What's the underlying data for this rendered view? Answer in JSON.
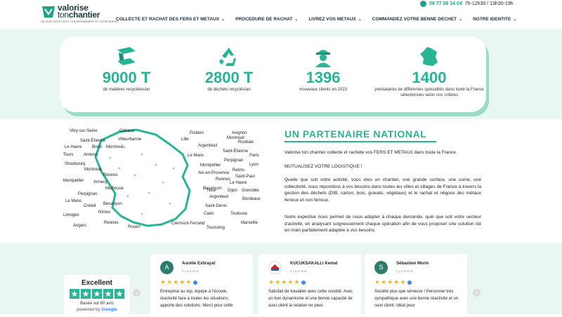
{
  "header": {
    "brand_line1": "valorise",
    "brand_line2a": "ton",
    "brand_line2b": "chantier",
    "tagline": "ON VOUS INCITE AVEC L'ENVIRONNEMENT ET VOTRE BUDGET",
    "phone": "09 77 08 14 04",
    "hours": "7h-12h30 / 13h30-19h",
    "nav": [
      {
        "label": "COLLECTE ET RACHAT DES FERS ET METAUX"
      },
      {
        "label": "PROCEDURE DE RACHAT"
      },
      {
        "label": "LIVREZ VOS METAUX"
      },
      {
        "label": "COMMANDEZ VOTRE BENNE DECHET"
      },
      {
        "label": "NOTRE IDENTITE"
      }
    ]
  },
  "stats": [
    {
      "icon": "steel-beam-icon",
      "value": "9000 T",
      "label": "de matières recyclées/an"
    },
    {
      "icon": "recycle-icon",
      "value": "2800 T",
      "label": "de déchets recyclés/an"
    },
    {
      "icon": "worker-icon",
      "value": "1396",
      "label": "nouveaux clients en 2023"
    },
    {
      "icon": "france-map-icon",
      "value": "1400",
      "label": "prestataires de différentes spécialités dans toute la France sélectionnés selon nos critères"
    }
  ],
  "map_cities_left": [
    "Vitry-sur-Seine",
    "Orléans",
    "Saint-Étienne",
    "Villeurbanne",
    "Le Havre",
    "Brest",
    "Montreuil",
    "Tours",
    "Amiens",
    "Strasbourg",
    "Montreuil",
    "Rennes",
    "Montpellier",
    "Annecy",
    "Mulhouse",
    "Perpignan",
    "Le Mans",
    "Besançon",
    "Créteil",
    "Nîmes",
    "Limoges",
    "Angers",
    "Rennes",
    "Rouen"
  ],
  "map_cities_right": [
    "Poitiers",
    "Avignon",
    "Montreuil",
    "Lille",
    "Roubaix",
    "Argenteuil",
    "Saint-Étienne",
    "Le Mans",
    "Paris",
    "Perpignan",
    "Montpellier",
    "Lyon",
    "Reims",
    "Aix-en-Provence",
    "Saint-Paul",
    "Rennes",
    "Le Havre",
    "Besançon",
    "Nice",
    "Dijon",
    "Grenoble",
    "Argenteuil",
    "Bordeaux",
    "Saint-Denis",
    "Caen",
    "Toulouse",
    "Clermont-Ferrand",
    "Marseille",
    "Tourcoing"
  ],
  "partner": {
    "title": "UN PARTENAIRE NATIONAL",
    "p1": "Valorise ton chantier collecte et rachète vos FERS ET METAUX  dans toute la France.",
    "p2": "MUTUALISEZ VOTRE LOGISTIQUE !",
    "p3": "Quelle que soit votre activité, vous etes un chantier, une grande surface, une usine, une collectivité, nous répondons à vos besoins dans toutes les villes et villages de France à travers la gestion des déchets (DIB, carton, bois, gravats, végétaux) et le rachat et négoce des métaux ferreux et non ferreux.",
    "p4": "Notre expertise nous permet de nous adapter à chaque demande, quel que soit votre secteur d'activité, en analysant soigneusement chaque opération afin de vous proposer une solution clé en main parfaitement adaptée à vos besoins."
  },
  "rating": {
    "title": "Excellent",
    "based": "Basée sur 60 avis",
    "powered": "powered by",
    "google": "Google"
  },
  "reviews": [
    {
      "initial": "A",
      "color": "#2e7d6b",
      "name": "Aurelie Exbrayat",
      "ago": "Il y a 6 mois",
      "text": "Entreprise au top, équipe à l'écoute, réactivité face à toutes les situations, apporte des solutions. Merci pour cette"
    },
    {
      "initial": "",
      "color": "#ffffff",
      "name": "KUCUKSAKALLI Kemal",
      "ago": "Il y a 6 mois",
      "text": "Satisfait de travailler avec cette société. Avec un bon dynamisme et une bonne capacité de suivi client la relation ne peut-"
    },
    {
      "initial": "S",
      "color": "#2e7d6b",
      "name": "Sébastien Morin",
      "ago": "Il y a 6 mois",
      "text": "Société plus que sérieuse ! Personnel très sympathique avec une bonne réactivité et un suivi client. Idéal pour"
    }
  ],
  "colors": {
    "accent": "#27b596",
    "band": "#e9f7f1",
    "star": "#f6b900"
  }
}
